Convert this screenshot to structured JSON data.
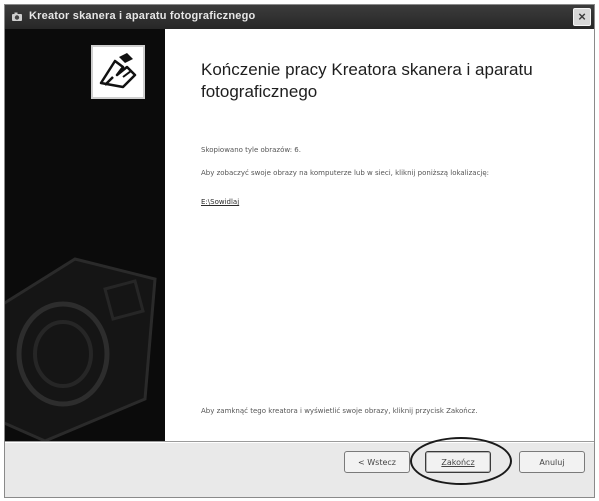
{
  "window": {
    "title": "Kreator skanera i aparatu fotograficznego",
    "icon": "wizard-camera-icon",
    "close_label": "×"
  },
  "sidebar": {
    "logo_icon": "scanner-wizard-logo-icon",
    "watermark_icon": "camera-watermark-icon"
  },
  "content": {
    "heading": "Kończenie pracy Kreatora skanera i aparatu fotograficznego",
    "status": "Skopiowano tyle obrazów: 6.",
    "info": "Aby zobaczyć swoje obrazy na komputerze lub w sieci, kliknij poniższą lokalizację:",
    "link": "E:\\Sowidlaj",
    "finish_instruction": "Aby zamknąć tego kreatora i wyświetlić swoje obrazy, kliknij przycisk Zakończ."
  },
  "buttons": {
    "back": "< Wstecz",
    "finish": "Zakończ",
    "cancel": "Anuluj"
  },
  "colors": {
    "titlebar": "#333333",
    "sidebar": "#0b0b0b",
    "dialog_bg": "#e9e9e9",
    "highlight": "#1a1a1a"
  }
}
